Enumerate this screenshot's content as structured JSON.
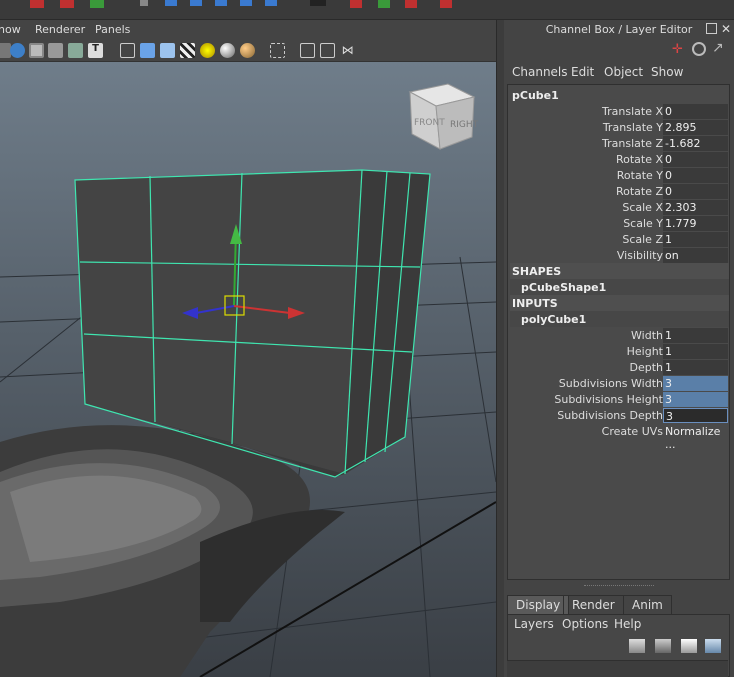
{
  "viewport": {
    "menu": [
      "how",
      "Renderer",
      "Panels"
    ],
    "viewcube": {
      "front": "FRONT",
      "right": "RIGHT"
    }
  },
  "channel_box": {
    "title": "Channel Box / Layer Editor",
    "menu": [
      "Channels",
      "Edit",
      "Object",
      "Show"
    ],
    "object": "pCube1",
    "transform_attrs": [
      {
        "label": "Translate X",
        "value": "0"
      },
      {
        "label": "Translate Y",
        "value": "2.895"
      },
      {
        "label": "Translate Z",
        "value": "-1.682"
      },
      {
        "label": "Rotate X",
        "value": "0"
      },
      {
        "label": "Rotate Y",
        "value": "0"
      },
      {
        "label": "Rotate Z",
        "value": "0"
      },
      {
        "label": "Scale X",
        "value": "2.303"
      },
      {
        "label": "Scale Y",
        "value": "1.779"
      },
      {
        "label": "Scale Z",
        "value": "1"
      },
      {
        "label": "Visibility",
        "value": "on"
      }
    ],
    "shapes_header": "SHAPES",
    "shape_node": "pCubeShape1",
    "inputs_header": "INPUTS",
    "input_node": "polyCube1",
    "input_attrs": [
      {
        "label": "Width",
        "value": "1"
      },
      {
        "label": "Height",
        "value": "1"
      },
      {
        "label": "Depth",
        "value": "1"
      },
      {
        "label": "Subdivisions Width",
        "value": "3"
      },
      {
        "label": "Subdivisions Height",
        "value": "3"
      },
      {
        "label": "Subdivisions Depth",
        "value": "3"
      },
      {
        "label": "Create UVs",
        "value": "Normalize ..."
      }
    ]
  },
  "layer_editor": {
    "tabs": [
      "Display",
      "Render",
      "Anim"
    ],
    "active_tab": "Display",
    "menu": [
      "Layers",
      "Options",
      "Help"
    ]
  },
  "colors": {
    "wireframe": "#3fe6b0",
    "selection_field": "#5a7fa8",
    "panel": "#444444"
  }
}
